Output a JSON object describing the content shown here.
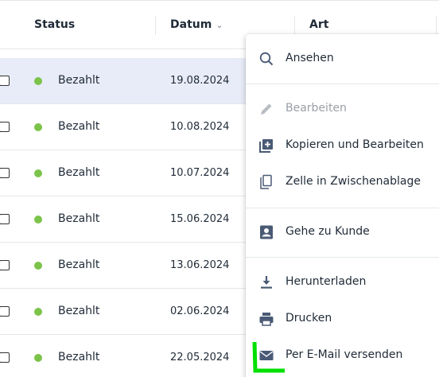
{
  "table": {
    "columns": {
      "status": "Status",
      "datum": "Datum",
      "art": "Art",
      "sort_icon": "chevron-down-icon"
    },
    "rows": [
      {
        "status": "Bezahlt",
        "date": "19.08.2024"
      },
      {
        "status": "Bezahlt",
        "date": "10.08.2024"
      },
      {
        "status": "Bezahlt",
        "date": "10.07.2024"
      },
      {
        "status": "Bezahlt",
        "date": "15.06.2024"
      },
      {
        "status": "Bezahlt",
        "date": "13.06.2024"
      },
      {
        "status": "Bezahlt",
        "date": "02.06.2024"
      },
      {
        "status": "Bezahlt",
        "date": "22.05.2024"
      }
    ],
    "status_color": "#7cc34a",
    "selected_row_color": "#e8ecf8"
  },
  "menu": {
    "items": [
      {
        "label": "Ansehen",
        "icon": "search-icon"
      },
      {
        "label": "Bearbeiten",
        "icon": "pencil-icon",
        "disabled": true
      },
      {
        "label": "Kopieren und Bearbeiten",
        "icon": "copy-plus-icon"
      },
      {
        "label": "Zelle in Zwischenablage",
        "icon": "clipboard-copy-icon"
      },
      {
        "label": "Gehe zu Kunde",
        "icon": "contact-icon"
      },
      {
        "label": "Herunterladen",
        "icon": "download-icon"
      },
      {
        "label": "Drucken",
        "icon": "print-icon"
      },
      {
        "label": "Per E-Mail versenden",
        "icon": "mail-icon"
      }
    ],
    "icon_color": "#4a5a75",
    "highlight_color": "#00e000"
  }
}
